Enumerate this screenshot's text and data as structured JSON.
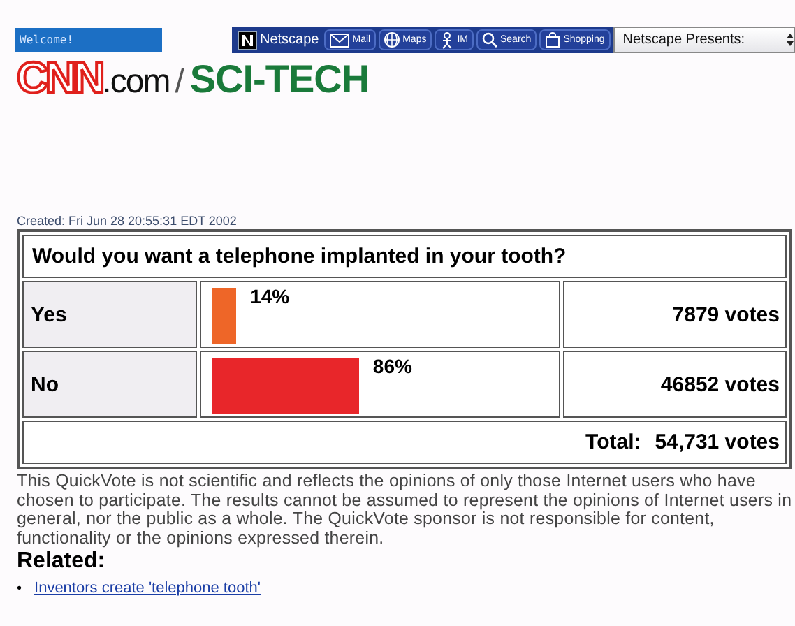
{
  "browser_bar": {
    "welcome": "Welcome!",
    "toolbar": [
      {
        "kind": "netscape",
        "label": "Netscape"
      },
      {
        "kind": "mail",
        "label": "Mail"
      },
      {
        "kind": "maps",
        "label": "Maps"
      },
      {
        "kind": "im",
        "label": "IM"
      },
      {
        "kind": "search",
        "label": "Search"
      },
      {
        "kind": "shopping",
        "label": "Shopping"
      }
    ],
    "dropdown": "Netscape Presents:"
  },
  "header": {
    "logo": "CNN",
    "domain": ".com",
    "separator": "/",
    "section": "SCI-TECH"
  },
  "poll": {
    "created": "Created: Fri Jun 28 20:55:31 EDT 2002",
    "question": "Would you want a telephone implanted in your tooth?",
    "answers": [
      {
        "label": "Yes",
        "percent": "14%",
        "color": "#ee6628",
        "votes": "7879 votes"
      },
      {
        "label": "No",
        "percent": "86%",
        "color": "#e8262a",
        "votes": "46852 votes"
      }
    ],
    "total_label": "Total:",
    "total": "54,731 votes"
  },
  "disclaimer": "This QuickVote is not scientific and reflects the opinions of only those Internet users who have chosen to participate. The results cannot be assumed to represent the opinions of Internet users in general, nor the public as a whole. The QuickVote sponsor is not responsible for content, functionality or the opinions expressed therein.",
  "related": {
    "heading": "Related:",
    "links": [
      {
        "bullet": "•",
        "text": "Inventors create 'telephone tooth'"
      }
    ]
  }
}
